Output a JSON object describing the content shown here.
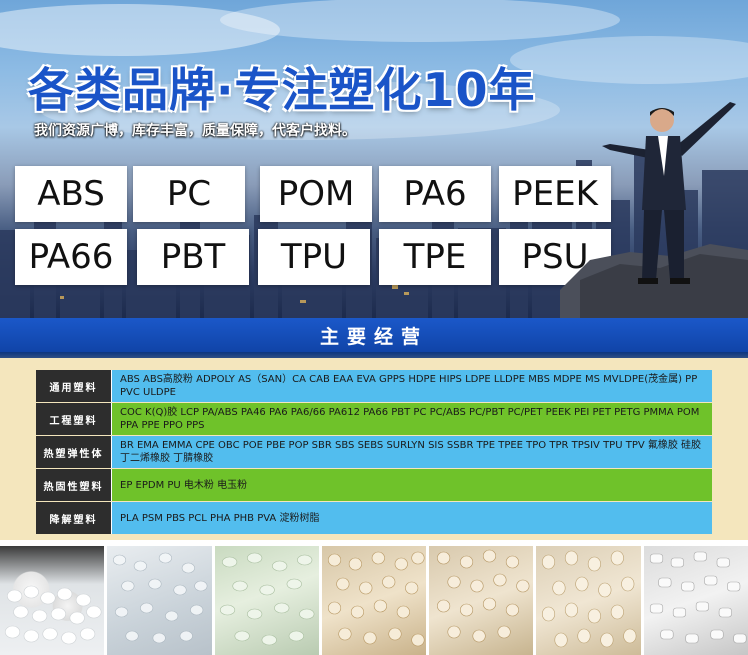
{
  "banner": {
    "headline": "各类品牌·专注塑化10年",
    "subline": "我们资源广博，库存丰富，质量保障，代客户找料。",
    "brands_row1": [
      "ABS",
      "PC",
      "POM",
      "PA6",
      "PEEK"
    ],
    "brands_row2": [
      "PA66",
      "PBT",
      "TPU",
      "TPE",
      "PSU"
    ]
  },
  "section": {
    "title": "主要经营"
  },
  "categories": [
    {
      "label": "通用塑料",
      "color": "#52bdee",
      "items": "ABS ABS高胶粉 ADPOLY AS（SAN）CA CAB EAA EVA GPPS HDPE HIPS  LDPE LLDPE MBS MDPE MS MVLDPE(茂金属) PP PVC ULDPE"
    },
    {
      "label": "工程塑料",
      "color": "#6fc22a",
      "items": "COC K(Q)胶 LCP PA/ABS PA46 PA6 PA6/66 PA612 PA66 PBT PC PC/ABS PC/PBT PC/PET PEEK PEI PET PETG PMMA POM PPA PPE PPO PPS"
    },
    {
      "label": "热塑弹性体",
      "color": "#52bdee",
      "items": "BR EMA EMMA CPE OBC POE PBE POP SBR SBS SEBS SURLYN SIS SSBR TPE TPEE TPO TPR TPSIV TPU TPV 氟橡胶 硅胶 丁二烯橡胶 丁腈橡胶"
    },
    {
      "label": "热固性塑料",
      "color": "#6fc22a",
      "items": "EP EPDM PU 电木粉 电玉粉"
    },
    {
      "label": "降解塑料",
      "color": "#52bdee",
      "items": "PLA PSM PBS PCL PHA PHB PVA 淀粉树脂"
    }
  ],
  "photos": [
    "white-pellets",
    "clear-pellets",
    "green-tint-pellets",
    "amber-pellets",
    "amber-pellets",
    "amber-pellets",
    "white-cylinder-pellets"
  ],
  "colors": {
    "headline": "#1a54c8",
    "title_bar": "#1b58c9",
    "table_bg": "#f4e6bd"
  }
}
